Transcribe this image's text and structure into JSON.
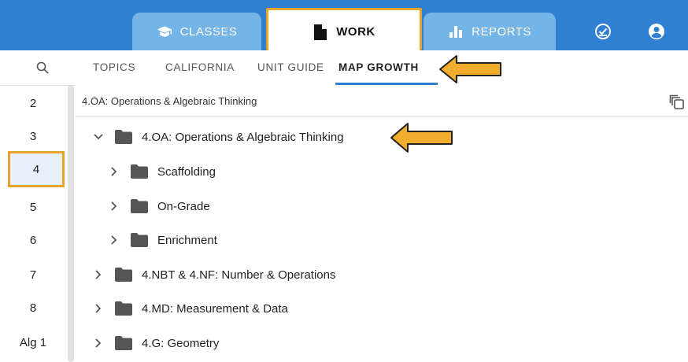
{
  "topbar": {
    "tabs": [
      {
        "label": "CLASSES",
        "icon": "graduation-cap-icon"
      },
      {
        "label": "WORK",
        "icon": "document-icon"
      },
      {
        "label": "REPORTS",
        "icon": "bar-chart-icon"
      }
    ],
    "right_icons": [
      "check-circle-icon",
      "account-circle-icon"
    ]
  },
  "subtabs": [
    {
      "label": "TOPICS"
    },
    {
      "label": "CALIFORNIA"
    },
    {
      "label": "UNIT GUIDE"
    },
    {
      "label": "MAP GROWTH"
    }
  ],
  "grades": [
    "2",
    "3",
    "4",
    "5",
    "6",
    "7",
    "8",
    "Alg 1"
  ],
  "selected_grade": "4",
  "breadcrumb": "4.OA: Operations & Algebraic Thinking",
  "tree": [
    {
      "label": "4.OA: Operations & Algebraic Thinking",
      "expanded": true,
      "level": 0
    },
    {
      "label": "Scaffolding",
      "expanded": false,
      "level": 1
    },
    {
      "label": "On-Grade",
      "expanded": false,
      "level": 1
    },
    {
      "label": "Enrichment",
      "expanded": false,
      "level": 1
    },
    {
      "label": "4.NBT & 4.NF: Number & Operations",
      "expanded": false,
      "level": 0
    },
    {
      "label": "4.MD: Measurement & Data",
      "expanded": false,
      "level": 0
    },
    {
      "label": "4.G: Geometry",
      "expanded": false,
      "level": 0
    }
  ],
  "colors": {
    "primary": "#2f7fd3",
    "tab_inactive": "#74b4e6",
    "highlight": "#e5a52d",
    "folder": "#555555"
  }
}
